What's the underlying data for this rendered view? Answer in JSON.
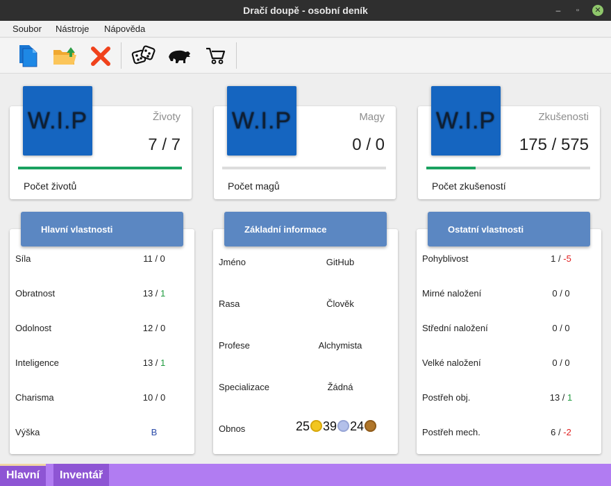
{
  "window": {
    "title": "Dračí doupě - osobní deník",
    "minimize_glyph": "–",
    "maximize_glyph": "▫",
    "close_glyph": "✕"
  },
  "menu": {
    "items": [
      "Soubor",
      "Nástroje",
      "Nápověda"
    ]
  },
  "toolbar": {
    "icons": [
      "new-document-icon",
      "open-folder-icon",
      "delete-icon",
      "dice-icon",
      "bear-icon",
      "cart-icon"
    ]
  },
  "stats": [
    {
      "image_text": "W.I.P",
      "name": "Životy",
      "value": "7 / 7",
      "label": "Počet životů",
      "progress": 1.0
    },
    {
      "image_text": "W.I.P",
      "name": "Magy",
      "value": "0 / 0",
      "label": "Počet magů",
      "progress": 0.0
    },
    {
      "image_text": "W.I.P",
      "name": "Zkušenosti",
      "value": "175 / 575",
      "label": "Počet zkušeností",
      "progress": 0.3
    }
  ],
  "main_attributes": {
    "title": "Hlavní vlastnosti",
    "rows": [
      {
        "label": "Síla",
        "base": "11",
        "sep": " / ",
        "bonus": "0",
        "bonus_color": "normal"
      },
      {
        "label": "Obratnost",
        "base": "13",
        "sep": " / ",
        "bonus": "1",
        "bonus_color": "green"
      },
      {
        "label": "Odolnost",
        "base": "12",
        "sep": " / ",
        "bonus": "0",
        "bonus_color": "normal"
      },
      {
        "label": "Inteligence",
        "base": "13",
        "sep": " / ",
        "bonus": "1",
        "bonus_color": "green"
      },
      {
        "label": "Charisma",
        "base": "10",
        "sep": " / ",
        "bonus": "0",
        "bonus_color": "normal"
      },
      {
        "label": "Výška",
        "base": "B",
        "sep": "",
        "bonus": "",
        "bonus_color": "blue"
      }
    ]
  },
  "basic_info": {
    "title": "Základní informace",
    "rows": [
      {
        "label": "Jméno",
        "value": "GitHub"
      },
      {
        "label": "Rasa",
        "value": "Člověk"
      },
      {
        "label": "Profese",
        "value": "Alchymista"
      },
      {
        "label": "Specializace",
        "value": "Žádná"
      }
    ],
    "wealth": {
      "label": "Obnos",
      "gold": "25",
      "silver": "39",
      "copper": "24"
    }
  },
  "other_attributes": {
    "title": "Ostatní vlastnosti",
    "rows": [
      {
        "label": "Pohyblivost",
        "base": "1",
        "bonus": "-5",
        "bonus_color": "red"
      },
      {
        "label": "Mirné naložení",
        "base": "0",
        "bonus": "0",
        "bonus_color": "normal"
      },
      {
        "label": "Střední naložení",
        "base": "0",
        "bonus": "0",
        "bonus_color": "normal"
      },
      {
        "label": "Velké naložení",
        "base": "0",
        "bonus": "0",
        "bonus_color": "normal"
      },
      {
        "label": "Postřeh obj.",
        "base": "13",
        "bonus": "1",
        "bonus_color": "green"
      },
      {
        "label": "Postřeh mech.",
        "base": "6",
        "bonus": "-2",
        "bonus_color": "red"
      }
    ]
  },
  "tabs": [
    {
      "label": "Hlavní",
      "active": true
    },
    {
      "label": "Inventář",
      "active": false
    }
  ],
  "colors": {
    "wip_blue": "#1565c0",
    "panel_header": "#5b87c2",
    "progress_green": "#1aa260",
    "tab_bar": "#b17cf2",
    "tab_active": "#8e55d4"
  }
}
